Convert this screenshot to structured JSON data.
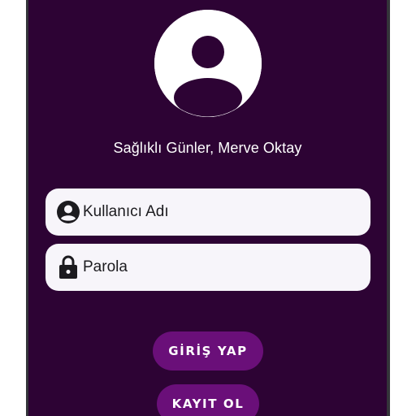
{
  "greeting": "Sağlıklı Günler, Merve Oktay",
  "username_field": {
    "placeholder": "Kullanıcı Adı",
    "icon": "account-circle-icon"
  },
  "password_field": {
    "placeholder": "Parola",
    "icon": "lock-icon"
  },
  "buttons": {
    "login_label": "GİRİŞ YAP",
    "register_label": "KAYIT OL"
  },
  "avatar_icon": "account-circle-icon",
  "colors": {
    "background": "#2d0334",
    "button": "#6a0f79",
    "field": "#f7f5fa",
    "text_light": "#ffffff",
    "text_dark": "#1c1b1f"
  }
}
